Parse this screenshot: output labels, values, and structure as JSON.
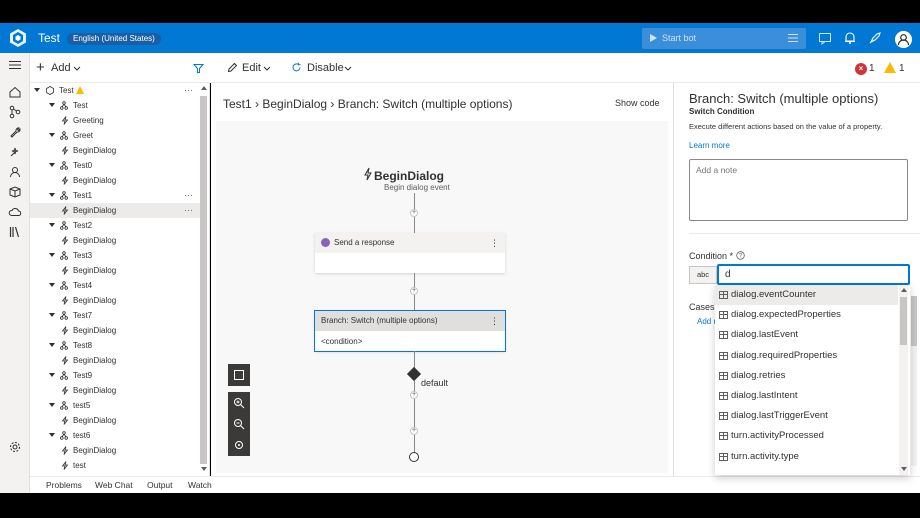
{
  "header": {
    "app_title": "Test",
    "locale": "English (United States)",
    "start_bot": "Start bot"
  },
  "toolbar": {
    "add": "Add",
    "edit": "Edit",
    "disable": "Disable",
    "error_count": "1",
    "warning_count": "1"
  },
  "tree": {
    "root": "Test",
    "items": [
      {
        "label": "Test",
        "kind": "dialog"
      },
      {
        "label": "Greeting",
        "kind": "trigger"
      },
      {
        "label": "Greet",
        "kind": "dialog"
      },
      {
        "label": "BeginDialog",
        "kind": "trigger"
      },
      {
        "label": "Test0",
        "kind": "dialog"
      },
      {
        "label": "BeginDialog",
        "kind": "trigger"
      },
      {
        "label": "Test1",
        "kind": "dialog"
      },
      {
        "label": "BeginDialog",
        "kind": "trigger"
      },
      {
        "label": "Test2",
        "kind": "dialog"
      },
      {
        "label": "BeginDialog",
        "kind": "trigger"
      },
      {
        "label": "Test3",
        "kind": "dialog"
      },
      {
        "label": "BeginDialog",
        "kind": "trigger"
      },
      {
        "label": "Test4",
        "kind": "dialog"
      },
      {
        "label": "BeginDialog",
        "kind": "trigger"
      },
      {
        "label": "Test7",
        "kind": "dialog"
      },
      {
        "label": "BeginDialog",
        "kind": "trigger"
      },
      {
        "label": "Test8",
        "kind": "dialog"
      },
      {
        "label": "BeginDialog",
        "kind": "trigger"
      },
      {
        "label": "Test9",
        "kind": "dialog"
      },
      {
        "label": "BeginDialog",
        "kind": "trigger"
      },
      {
        "label": "test5",
        "kind": "dialog"
      },
      {
        "label": "BeginDialog",
        "kind": "trigger"
      },
      {
        "label": "test6",
        "kind": "dialog"
      },
      {
        "label": "BeginDialog",
        "kind": "trigger"
      },
      {
        "label": "test",
        "kind": "trigger"
      }
    ]
  },
  "canvas": {
    "breadcrumb": "Test1  ›  BeginDialog  ›  Branch: Switch (multiple options)",
    "show_code": "Show code",
    "flow_title": "BeginDialog",
    "flow_subtitle": "Begin dialog event",
    "card1_title": "Send a response",
    "card2_title": "Branch: Switch (multiple options)",
    "card2_body": "<condition>",
    "default_label": "default"
  },
  "bottombar": {
    "tabs": [
      "Problems",
      "Web Chat",
      "Output",
      "Watch"
    ]
  },
  "panel": {
    "title": "Branch: Switch (multiple options)",
    "subtitle": "Switch Condition",
    "description": "Execute different actions based on the value of a property.",
    "learn_more": "Learn more",
    "note_placeholder": "Add a note",
    "condition_label": "Condition *",
    "condition_type": "abc",
    "condition_value": "d",
    "cases_label": "Cases",
    "add_new": "Add n"
  },
  "suggestions": [
    "dialog.eventCounter",
    "dialog.expectedProperties",
    "dialog.lastEvent",
    "dialog.requiredProperties",
    "dialog.retries",
    "dialog.lastIntent",
    "dialog.lastTriggerEvent",
    "turn.activityProcessed",
    "turn.activity.type"
  ],
  "colors": {
    "brand": "#0078d4",
    "error": "#d13438",
    "warning": "#ffb900"
  }
}
